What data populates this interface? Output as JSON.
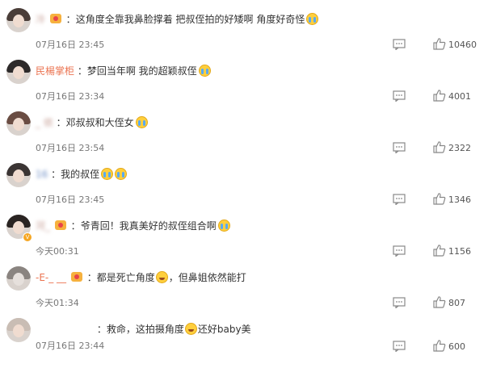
{
  "comments": [
    {
      "username": "冷",
      "text": "这角度全靠我鼻脸撑着 把叔侄拍的好矮啊 角度好奇怪",
      "emoji": [
        "cry"
      ],
      "fan_badge": true,
      "time": "07月16日 23:45",
      "likes": "10460",
      "vip": false
    },
    {
      "username": "民楊掌柜",
      "text": "梦回当年啊 我的超颖叔侄",
      "emoji": [
        "cry"
      ],
      "fan_badge": false,
      "time": "07月16日 23:34",
      "likes": "4001",
      "vip": false
    },
    {
      "username": "_ 侬",
      "text": "邓叔叔和大侄女",
      "emoji": [
        "cry"
      ],
      "fan_badge": false,
      "time": "07月16日 23:54",
      "likes": "2322",
      "vip": false
    },
    {
      "username": "16",
      "text": "我的叔侄",
      "emoji": [
        "cry",
        "cry"
      ],
      "fan_badge": false,
      "time": "07月16日 23:45",
      "likes": "1346",
      "vip": false
    },
    {
      "username": "河_",
      "text": "爷青回！我真美好的叔侄组合啊",
      "emoji": [
        "cry"
      ],
      "fan_badge": true,
      "time": "今天00:31",
      "likes": "1156",
      "vip": true
    },
    {
      "username": "-E-_ __",
      "text_a": "都是死亡角度",
      "text_b": "，但鼻姐依然能打",
      "emoji": [],
      "fan_badge": true,
      "time": "今天01:34",
      "likes": "807",
      "vip": false
    },
    {
      "username": "",
      "text_a": "救命，这拍摄角度",
      "text_b": "还好baby美",
      "emoji": [],
      "fan_badge": false,
      "time": "07月16日 23:44",
      "likes": "600",
      "vip": false
    }
  ],
  "colors": {
    "username": "#eb7350",
    "text": "#333333",
    "time": "#777777",
    "accent_badge": "#f6b13e"
  },
  "icons": {
    "reply": "comment-icon",
    "like": "thumbs-up-icon",
    "emoji": "crying-face-icon",
    "laugh": "laughing-tears-icon"
  }
}
